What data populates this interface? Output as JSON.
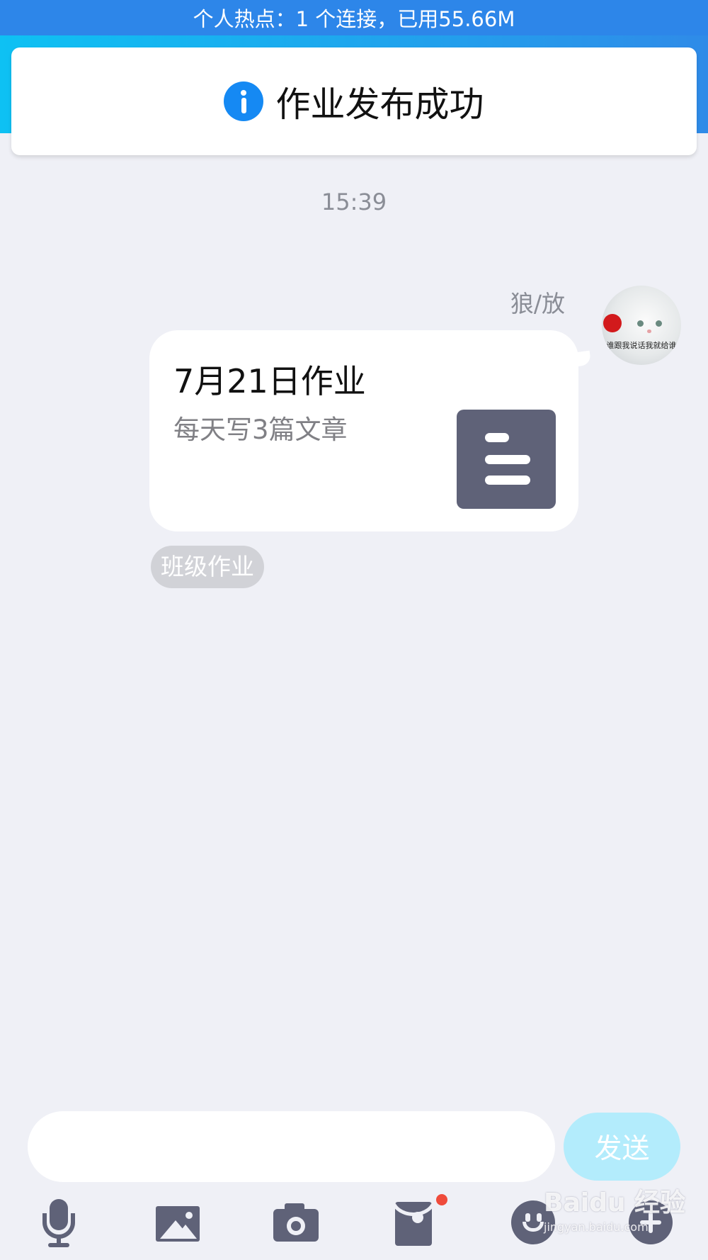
{
  "status_bar": {
    "hotspot_text": "个人热点：1 个连接，已用55.66M"
  },
  "toast": {
    "icon": "info-icon",
    "message": "作业发布成功"
  },
  "chat": {
    "timestamp": "15:39",
    "message": {
      "sender_name": "狼/放",
      "avatar_caption": "谁跟我说话我就给谁",
      "title": "7月21日作业",
      "description": "每天写3篇文章",
      "attachment_icon": "document-icon",
      "tag": "班级作业"
    }
  },
  "composer": {
    "input_value": "",
    "send_label": "发送"
  },
  "toolbar": {
    "items": [
      "microphone-icon",
      "image-icon",
      "camera-icon",
      "envelope-icon",
      "emoji-icon",
      "plus-icon"
    ],
    "envelope_badge": true
  },
  "watermark": {
    "main": "Baidu 经验",
    "sub": "jingyan.baidu.com"
  },
  "colors": {
    "status_bar": "#2d86e9",
    "toast_icon": "#1589f3",
    "background": "#eff0f6",
    "send_button": "#b3ecfc",
    "icon": "#5f6278",
    "badge": "#ef4b3b"
  }
}
